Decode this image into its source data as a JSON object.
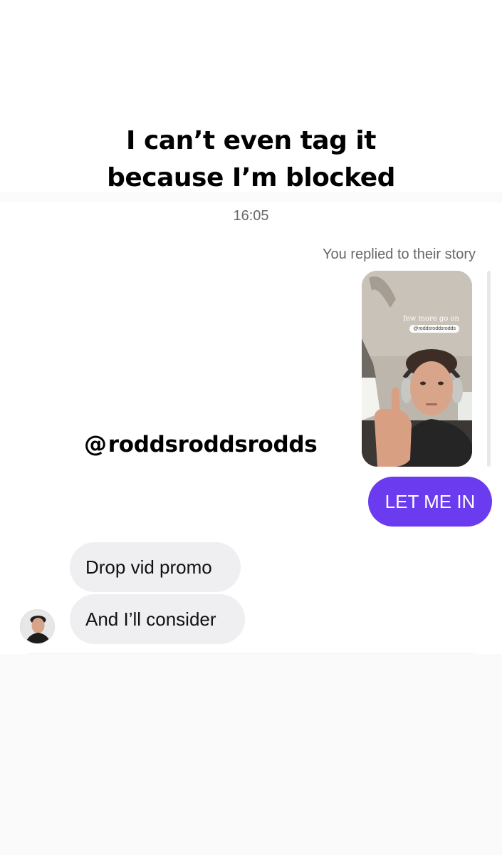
{
  "caption": {
    "line1": "I can’t even tag it",
    "line2": "because I’m blocked"
  },
  "thread": {
    "timestamp": "16:05",
    "story_reply_note": "You replied to their story",
    "story": {
      "overlay_text": "few more go on",
      "tag_text": "@roddsroddsrodds"
    },
    "threads_handle": {
      "icon": "threads-icon",
      "glyph": "@",
      "text": "roddsroddsrodds"
    },
    "sent_message": "LET ME IN",
    "received_messages": [
      "Drop vid promo",
      "And I’ll consider"
    ]
  },
  "colors": {
    "sent_bubble": "#6b3bf0",
    "received_bubble": "#efeff1",
    "meta_text": "#65676b"
  }
}
